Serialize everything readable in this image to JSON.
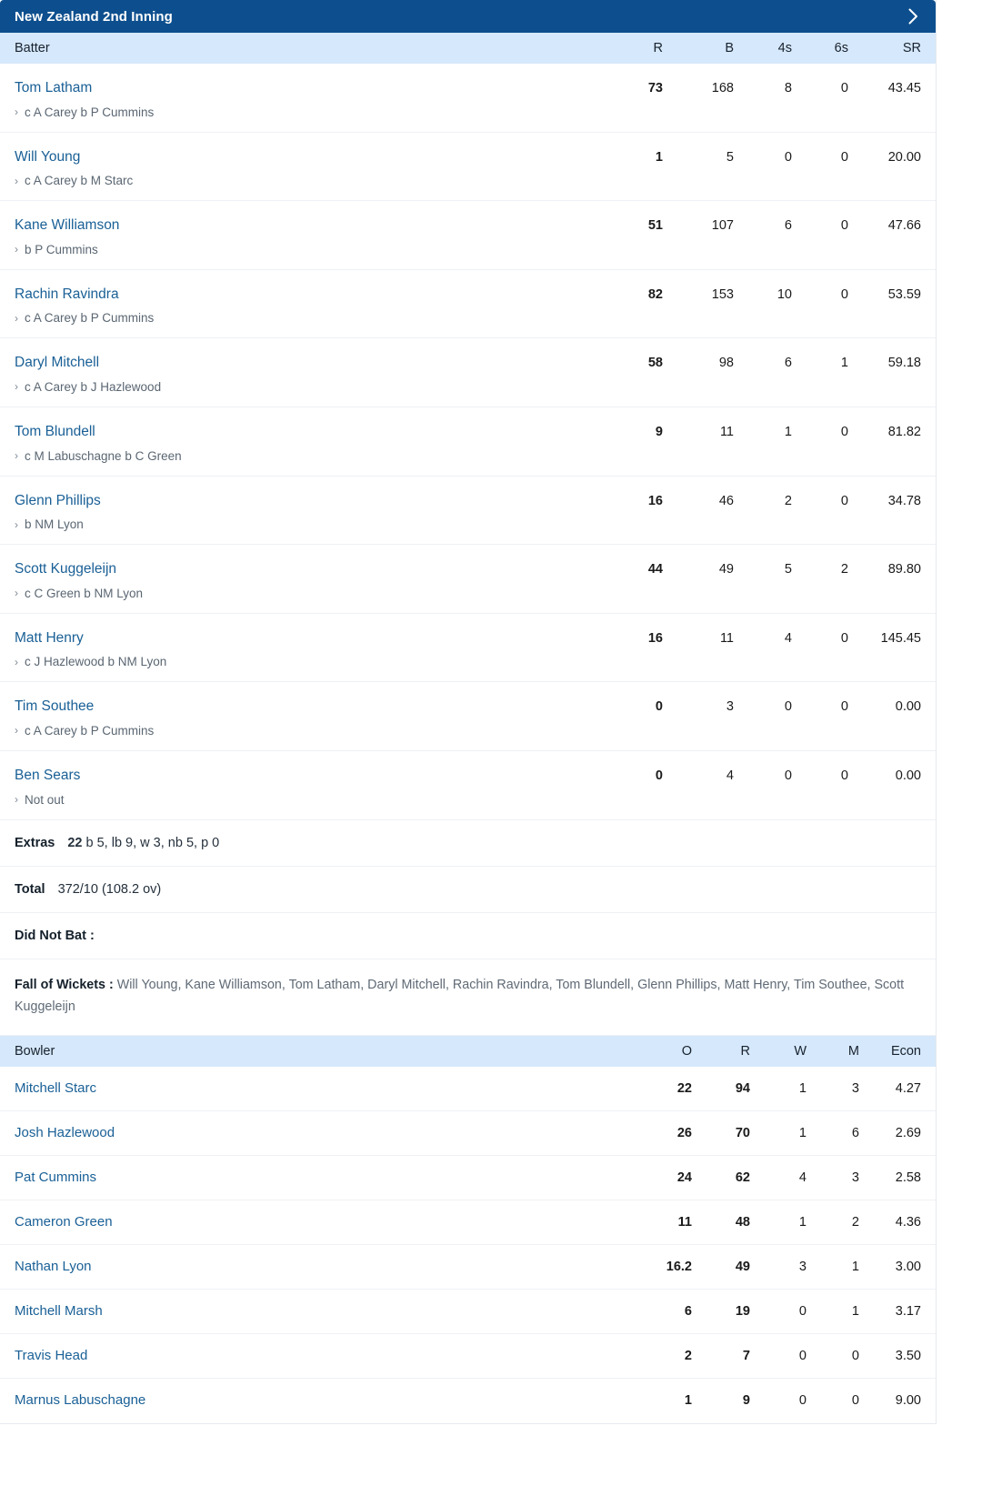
{
  "innings": {
    "title": "New Zealand 2nd Inning",
    "expand_icon": "chevron-right-icon"
  },
  "batting": {
    "headers": {
      "name": "Batter",
      "r": "R",
      "b": "B",
      "fours": "4s",
      "sixes": "6s",
      "sr": "SR"
    },
    "rows": [
      {
        "name": "Tom Latham",
        "dismissal": "c A Carey b P Cummins",
        "r": "73",
        "b": "168",
        "fours": "8",
        "sixes": "0",
        "sr": "43.45"
      },
      {
        "name": "Will Young",
        "dismissal": "c A Carey b M Starc",
        "r": "1",
        "b": "5",
        "fours": "0",
        "sixes": "0",
        "sr": "20.00"
      },
      {
        "name": "Kane Williamson",
        "dismissal": "b P Cummins",
        "r": "51",
        "b": "107",
        "fours": "6",
        "sixes": "0",
        "sr": "47.66"
      },
      {
        "name": "Rachin Ravindra",
        "dismissal": "c A Carey b P Cummins",
        "r": "82",
        "b": "153",
        "fours": "10",
        "sixes": "0",
        "sr": "53.59"
      },
      {
        "name": "Daryl Mitchell",
        "dismissal": "c A Carey b J Hazlewood",
        "r": "58",
        "b": "98",
        "fours": "6",
        "sixes": "1",
        "sr": "59.18"
      },
      {
        "name": "Tom Blundell",
        "dismissal": "c M Labuschagne b C Green",
        "r": "9",
        "b": "11",
        "fours": "1",
        "sixes": "0",
        "sr": "81.82"
      },
      {
        "name": "Glenn Phillips",
        "dismissal": "b NM Lyon",
        "r": "16",
        "b": "46",
        "fours": "2",
        "sixes": "0",
        "sr": "34.78"
      },
      {
        "name": "Scott Kuggeleijn",
        "dismissal": "c C Green b NM Lyon",
        "r": "44",
        "b": "49",
        "fours": "5",
        "sixes": "2",
        "sr": "89.80"
      },
      {
        "name": "Matt Henry",
        "dismissal": "c J Hazlewood b NM Lyon",
        "r": "16",
        "b": "11",
        "fours": "4",
        "sixes": "0",
        "sr": "145.45"
      },
      {
        "name": "Tim Southee",
        "dismissal": "c A Carey b P Cummins",
        "r": "0",
        "b": "3",
        "fours": "0",
        "sixes": "0",
        "sr": "0.00"
      },
      {
        "name": "Ben Sears",
        "dismissal": "Not out",
        "r": "0",
        "b": "4",
        "fours": "0",
        "sixes": "0",
        "sr": "0.00"
      }
    ]
  },
  "summary": {
    "extras_label": "Extras",
    "extras_value": "22",
    "extras_detail": "b 5, lb 9, w 3, nb 5, p 0",
    "total_label": "Total",
    "total_value": "372/10 (108.2 ov)",
    "did_not_bat_label": "Did Not Bat :",
    "did_not_bat_value": "",
    "fall_of_wickets_label": "Fall of Wickets :",
    "fall_of_wickets_value": "Will Young, Kane Williamson, Tom Latham, Daryl Mitchell, Rachin Ravindra, Tom Blundell, Glenn Phillips, Matt Henry, Tim Southee, Scott Kuggeleijn"
  },
  "bowling": {
    "headers": {
      "name": "Bowler",
      "o": "O",
      "r": "R",
      "w": "W",
      "m": "M",
      "econ": "Econ"
    },
    "rows": [
      {
        "name": "Mitchell Starc",
        "o": "22",
        "r": "94",
        "w": "1",
        "m": "3",
        "econ": "4.27"
      },
      {
        "name": "Josh Hazlewood",
        "o": "26",
        "r": "70",
        "w": "1",
        "m": "6",
        "econ": "2.69"
      },
      {
        "name": "Pat Cummins",
        "o": "24",
        "r": "62",
        "w": "4",
        "m": "3",
        "econ": "2.58"
      },
      {
        "name": "Cameron Green",
        "o": "11",
        "r": "48",
        "w": "1",
        "m": "2",
        "econ": "4.36"
      },
      {
        "name": "Nathan Lyon",
        "o": "16.2",
        "r": "49",
        "w": "3",
        "m": "1",
        "econ": "3.00"
      },
      {
        "name": "Mitchell Marsh",
        "o": "6",
        "r": "19",
        "w": "0",
        "m": "1",
        "econ": "3.17"
      },
      {
        "name": "Travis Head",
        "o": "2",
        "r": "7",
        "w": "0",
        "m": "0",
        "econ": "3.50"
      },
      {
        "name": "Marnus Labuschagne",
        "o": "1",
        "r": "9",
        "w": "0",
        "m": "0",
        "econ": "9.00"
      }
    ]
  },
  "colors": {
    "header_blue": "#0d4f8e",
    "column_head_blue": "#d6e8fb",
    "link_blue": "#1a6096"
  }
}
